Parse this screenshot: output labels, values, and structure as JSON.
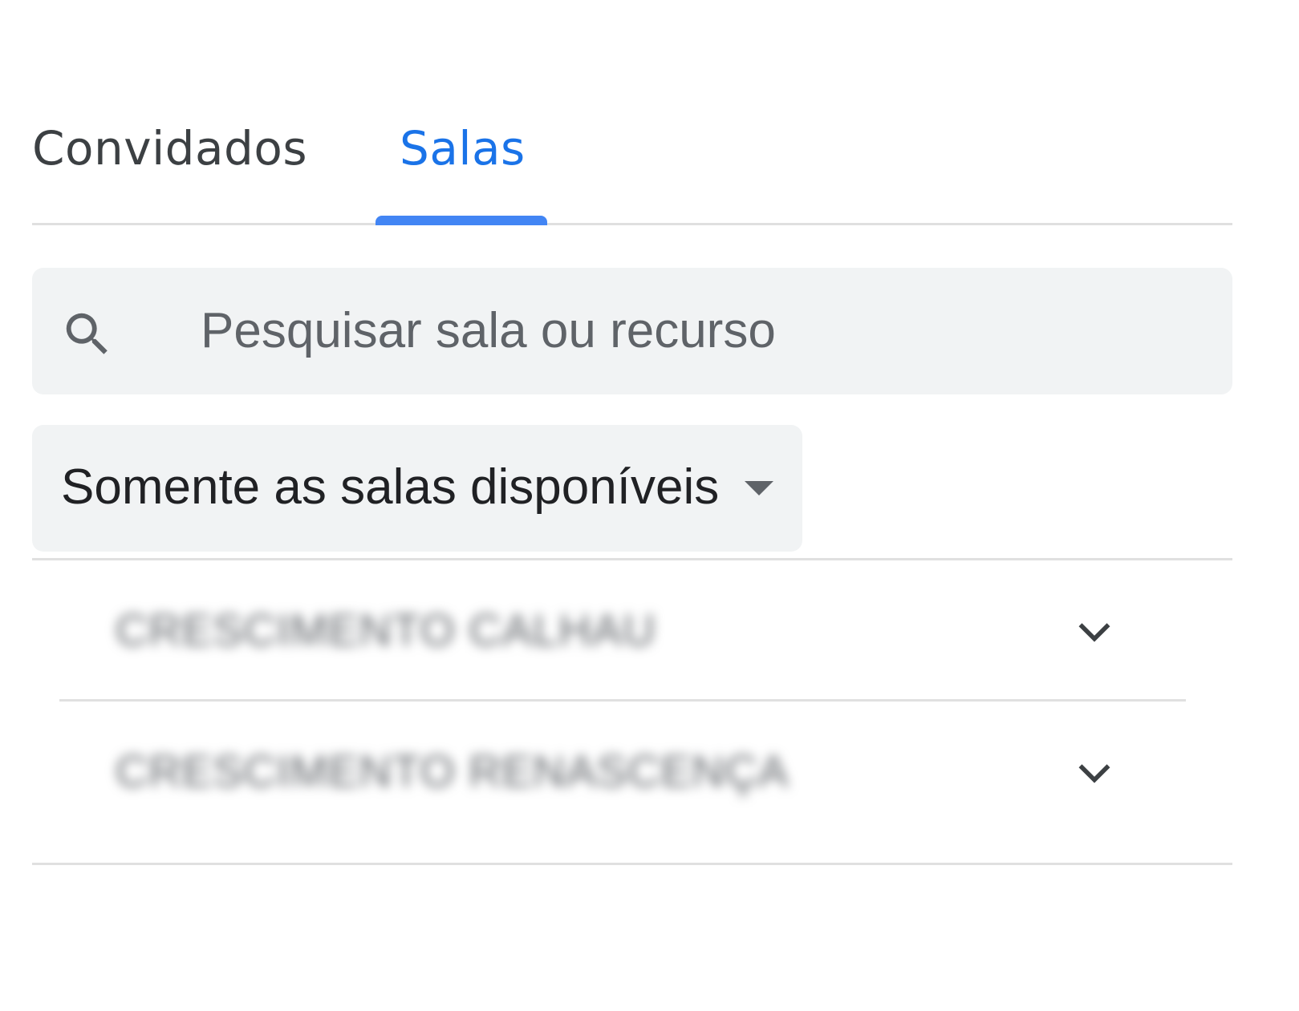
{
  "tabs": [
    {
      "label": "Convidados",
      "active": false
    },
    {
      "label": "Salas",
      "active": true
    }
  ],
  "search": {
    "placeholder": "Pesquisar sala ou recurso",
    "value": "",
    "icon": "search-icon"
  },
  "filter": {
    "selected": "Somente as salas disponíveis",
    "icon": "caret-down-icon"
  },
  "room_groups": [
    {
      "name": "CRESCIMENTO CALHAU",
      "blurred": true,
      "icon": "chevron-down-icon"
    },
    {
      "name": "CRESCIMENTO RENASCENÇA",
      "blurred": true,
      "icon": "chevron-down-icon"
    }
  ],
  "colors": {
    "accent": "#1a73e8",
    "tab_indicator": "#4285f4",
    "field_background": "#f1f3f4",
    "divider": "#e0e0e0",
    "text_primary": "#202124",
    "text_secondary": "#5f6368"
  }
}
